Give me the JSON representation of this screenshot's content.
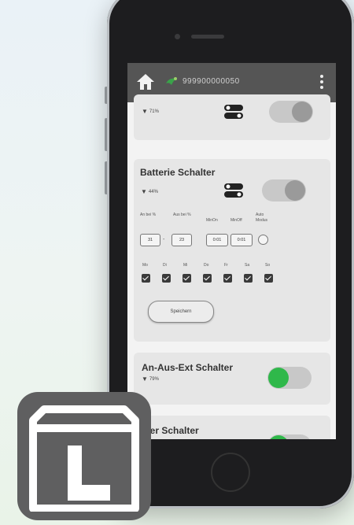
{
  "appbar": {
    "device_id": "999900000050"
  },
  "cards": [
    {
      "title": "",
      "signal": "71%"
    },
    {
      "title": "Batterie Schalter",
      "signal": "44%",
      "labels": {
        "an_bei": "An bei %",
        "aus_bei": "Aus bei %",
        "min_on": "MinOn",
        "min_off": "MinOff",
        "auto_modus": "Auto Modus"
      },
      "values": {
        "an_bei": "31",
        "dash": "-",
        "aus_bei": "23",
        "min_on": "0:01",
        "min_off": "0:01"
      },
      "days": [
        "Mo",
        "Di",
        "Mi",
        "Do",
        "Fr",
        "Sa",
        "So"
      ],
      "save_label": "Speichern"
    },
    {
      "title": "An-Aus-Ext Schalter",
      "signal": "79%",
      "toggle": "on"
    },
    {
      "title": "mer Schalter"
    }
  ],
  "colors": {
    "appbar": "#555555",
    "toggle_on": "#2fb84a",
    "app_icon": "#5f5f60"
  }
}
